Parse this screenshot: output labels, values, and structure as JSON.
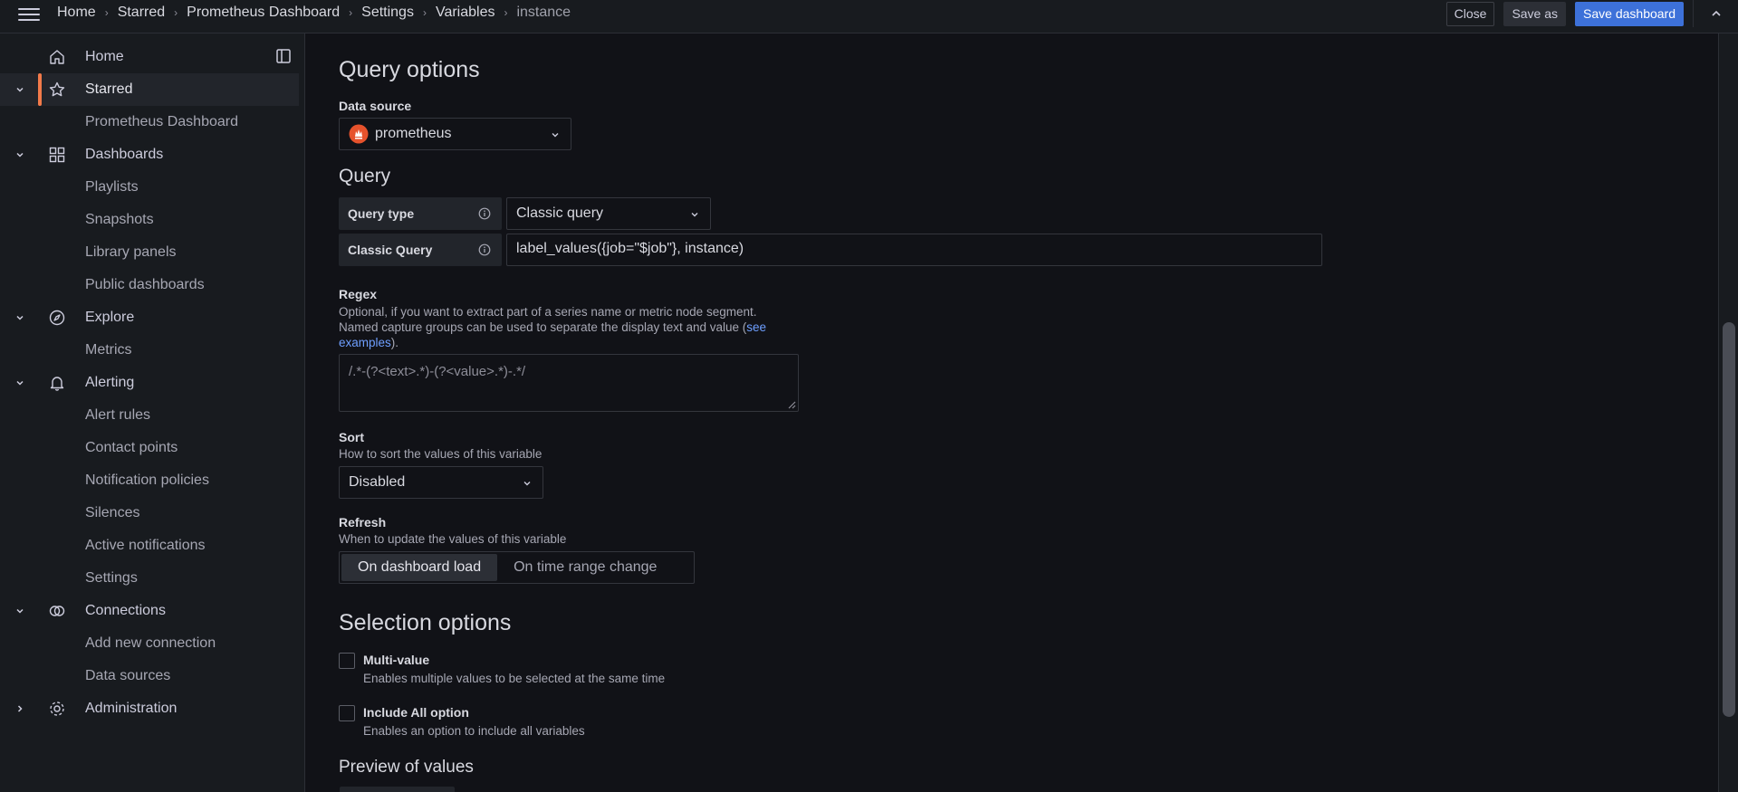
{
  "topbar": {
    "breadcrumbs": [
      "Home",
      "Starred",
      "Prometheus Dashboard",
      "Settings",
      "Variables",
      "instance"
    ],
    "close_label": "Close",
    "save_as_label": "Save as",
    "save_dashboard_label": "Save dashboard"
  },
  "sidebar": {
    "items": [
      {
        "label": "Home",
        "icon": "home-icon"
      },
      {
        "label": "Starred",
        "icon": "star-icon",
        "active": true
      },
      {
        "label": "Prometheus Dashboard"
      },
      {
        "label": "Dashboards",
        "icon": "apps-icon"
      },
      {
        "label": "Playlists"
      },
      {
        "label": "Snapshots"
      },
      {
        "label": "Library panels"
      },
      {
        "label": "Public dashboards"
      },
      {
        "label": "Explore",
        "icon": "compass-icon"
      },
      {
        "label": "Metrics"
      },
      {
        "label": "Alerting",
        "icon": "bell-icon"
      },
      {
        "label": "Alert rules"
      },
      {
        "label": "Contact points"
      },
      {
        "label": "Notification policies"
      },
      {
        "label": "Silences"
      },
      {
        "label": "Active notifications"
      },
      {
        "label": "Settings"
      },
      {
        "label": "Connections",
        "icon": "connections-icon"
      },
      {
        "label": "Add new connection"
      },
      {
        "label": "Data sources"
      },
      {
        "label": "Administration",
        "icon": "cog-icon"
      }
    ]
  },
  "main": {
    "query_options_title": "Query options",
    "data_source_label": "Data source",
    "data_source_value": "prometheus",
    "query_title": "Query",
    "query_type_label": "Query type",
    "query_type_value": "Classic query",
    "classic_query_label": "Classic Query",
    "classic_query_value": "label_values({job=\"$job\"}, instance)",
    "regex_label": "Regex",
    "regex_desc_1": "Optional, if you want to extract part of a series name or metric node segment.",
    "regex_desc_2": "Named capture groups can be used to separate the display text and value (",
    "regex_desc_link_a": "see",
    "regex_desc_link_b": "examples",
    "regex_desc_end": ").",
    "regex_placeholder": "/.*-(?<text>.*)-(?<value>.*)-.*/",
    "sort_label": "Sort",
    "sort_desc": "How to sort the values of this variable",
    "sort_value": "Disabled",
    "refresh_label": "Refresh",
    "refresh_desc": "When to update the values of this variable",
    "refresh_options": [
      "On dashboard load",
      "On time range change"
    ],
    "selection_title": "Selection options",
    "multi_value_label": "Multi-value",
    "multi_value_desc": "Enables multiple values to be selected at the same time",
    "include_all_label": "Include All option",
    "include_all_desc": "Enables an option to include all variables",
    "preview_title": "Preview of values"
  },
  "colors": {
    "accent": "#3d71d9",
    "active_bar": "#f27a4a",
    "link": "#6e9fff",
    "prometheus": "#e6522c"
  }
}
